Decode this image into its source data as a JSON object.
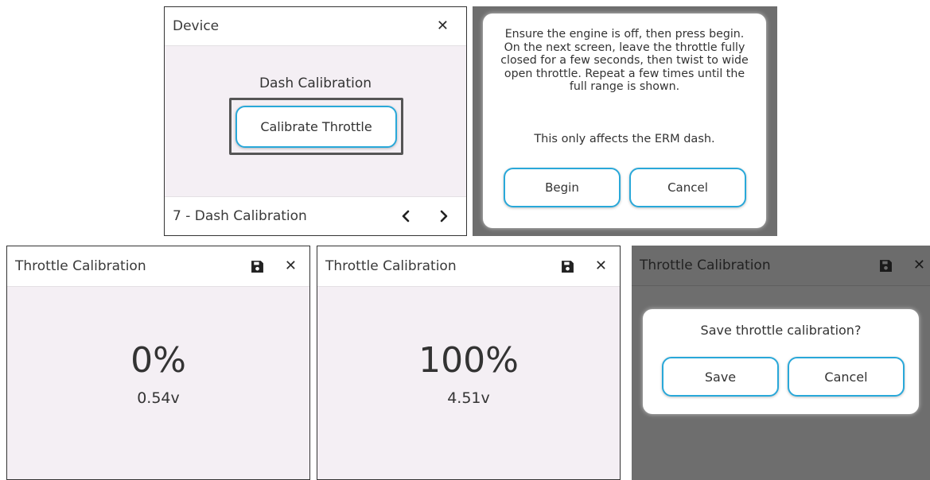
{
  "colors": {
    "accent": "#29a8d9",
    "panel_background": "#f4eff4",
    "overlay_background": "#6e6e6e",
    "dialog_background": "#ffffff",
    "text": "#333333"
  },
  "device_panel": {
    "title": "Device",
    "close_icon": "close-icon",
    "section_label": "Dash Calibration",
    "calibrate_button_label": "Calibrate Throttle",
    "footer_label": "7 - Dash Calibration",
    "prev_icon": "chevron-left-icon",
    "next_icon": "chevron-right-icon"
  },
  "info_dialog": {
    "instructions": "Ensure the engine is off, then press begin. On the next screen, leave the throttle fully closed for a few seconds, then twist to wide open throttle. Repeat a few times until the full range is shown.",
    "note": "This only affects the ERM dash.",
    "begin_label": "Begin",
    "cancel_label": "Cancel"
  },
  "calibration_closed": {
    "title": "Throttle Calibration",
    "save_icon": "save-icon",
    "close_icon": "close-icon",
    "percent": "0%",
    "voltage": "0.54v"
  },
  "calibration_open": {
    "title": "Throttle Calibration",
    "save_icon": "save-icon",
    "close_icon": "close-icon",
    "percent": "100%",
    "voltage": "4.51v"
  },
  "save_dialog_panel": {
    "title": "Throttle Calibration",
    "save_icon": "save-icon",
    "close_icon": "close-icon",
    "prompt": "Save throttle calibration?",
    "save_label": "Save",
    "cancel_label": "Cancel"
  }
}
